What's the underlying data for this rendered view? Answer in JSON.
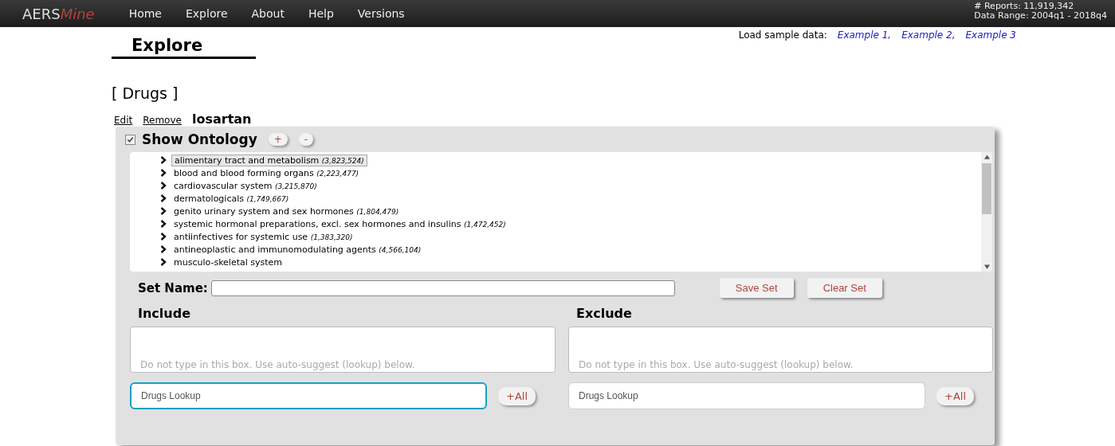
{
  "navbar": {
    "logo": {
      "part_1": "AERS",
      "part_2": "Mine"
    },
    "links": [
      "Home",
      "Explore",
      "About",
      "Help",
      "Versions"
    ],
    "stats": [
      "# Reports: 11,919,342",
      "Data Range: 2004q1 - 2018q4"
    ]
  },
  "sample_data": {
    "label": "Load sample data:",
    "links": [
      "Example 1,",
      "Example 2,",
      "Example 3"
    ]
  },
  "page_title": "Explore",
  "section_title": "[ Drugs ]",
  "drug_row": {
    "actions": [
      "Edit",
      "Remove"
    ],
    "name": "losartan"
  },
  "ontology": {
    "label": "Show Ontology",
    "checked": true,
    "buttons": [
      "+",
      "-"
    ],
    "items": [
      {
        "name": "alimentary tract and metabolism",
        "count": "(3,823,524)",
        "selected": true
      },
      {
        "name": "blood and blood forming organs",
        "count": "(2,223,477)",
        "selected": false
      },
      {
        "name": "cardiovascular system",
        "count": "(3,215,870)",
        "selected": false
      },
      {
        "name": "dermatologicals",
        "count": "(1,749,667)",
        "selected": false
      },
      {
        "name": "genito urinary system and sex hormones",
        "count": "(1,804,479)",
        "selected": false
      },
      {
        "name": "systemic hormonal preparations, excl. sex hormones and insulins",
        "count": "(1,472,452)",
        "selected": false
      },
      {
        "name": "antiinfectives for systemic use",
        "count": "(1,383,320)",
        "selected": false
      },
      {
        "name": "antineoplastic and immunomodulating agents",
        "count": "(4,566,104)",
        "selected": false
      },
      {
        "name": "musculo-skeletal system",
        "selected": false
      }
    ]
  },
  "set_name": {
    "label": "Set Name:",
    "buttons": [
      "Save Set",
      "Clear Set"
    ]
  },
  "panels": [
    {
      "title": "Include",
      "box_placeholder": "Do not type in this box. Use auto-suggest (lookup) below.",
      "lookup_placeholder": "Drugs Lookup",
      "focused": true,
      "button": "+All"
    },
    {
      "title": "Exclude",
      "box_placeholder": "Do not type in this box. Use auto-suggest (lookup) below.",
      "lookup_placeholder": "Drugs Lookup",
      "focused": false,
      "button": "+All"
    }
  ]
}
